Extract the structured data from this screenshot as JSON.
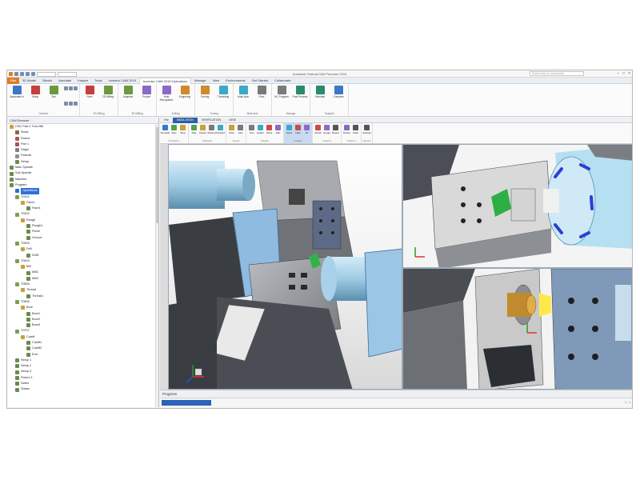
{
  "window": {
    "title": "Autodesk FeatureCAM Premium 2019",
    "search_placeholder": "Search key or commands",
    "controls": [
      "–",
      "□",
      "×"
    ]
  },
  "ribbon": {
    "tabs": [
      "File",
      "3D Model",
      "Sketch",
      "Annotate",
      "Inspect",
      "Tools",
      "Inventor CAM 2019",
      "Inventor CAM 2019 Operations",
      "Manage",
      "View",
      "Environments",
      "Get Started",
      "Collaborate"
    ],
    "active_tab": "Inventor CAM 2019 Operations",
    "groups": [
      {
        "label": "General",
        "buttons": [
          "Associate to",
          "Setup",
          "Tool"
        ]
      },
      {
        "label": "2D Milling",
        "buttons": [
          "Face",
          "2D Milling"
        ]
      },
      {
        "label": "3D Milling",
        "buttons": [
          "Adaptive",
          "Pocket"
        ]
      },
      {
        "label": "Drilling",
        "buttons": [
          "Hole Recognition",
          "Engraving"
        ]
      },
      {
        "label": "Turning",
        "buttons": [
          "Turning",
          "Threading"
        ]
      },
      {
        "label": "Multi-Axis",
        "buttons": [
          "Multi-Axis",
          "Flow"
        ]
      },
      {
        "label": "Manage",
        "buttons": [
          "NC Program",
          "Post Process"
        ]
      },
      {
        "label": "Toolpath",
        "buttons": [
          "Simulate",
          "Compare"
        ]
      }
    ]
  },
  "tree": {
    "header": "CAM Browser",
    "rows": [
      {
        "label": "CNC Part 1 Turn-Mill",
        "indent": 0,
        "color": "#c8a040"
      },
      {
        "label": "Stock",
        "indent": 1,
        "color": "#8a6a3a"
      },
      {
        "label": "Fixture",
        "indent": 1,
        "color": "#a05a5a"
      },
      {
        "label": "Part 1",
        "indent": 1,
        "color": "#b05050"
      },
      {
        "label": "Origin",
        "indent": 1,
        "color": "#808080"
      },
      {
        "label": "Feature",
        "indent": 1,
        "color": "#909090"
      },
      {
        "label": "Setup",
        "indent": 1,
        "color": "#6a8a50"
      },
      {
        "label": "Main Spindle",
        "indent": 0,
        "color": "#6a8a50"
      },
      {
        "label": "Sub Spindle",
        "indent": 0,
        "color": "#6a8a50"
      },
      {
        "label": "Machine",
        "indent": 0,
        "color": "#6a8a50"
      },
      {
        "label": "Program",
        "indent": 0,
        "color": "#6a8a50"
      },
      {
        "label": "Operations",
        "indent": 1,
        "color": "#2f6fd6",
        "selected": true
      },
      {
        "label": "T0101",
        "indent": 1,
        "color": "#7aa04a"
      },
      {
        "label": "Face1",
        "indent": 2,
        "color": "#c9a03a"
      },
      {
        "label": "Face1",
        "indent": 3,
        "color": "#6a8a50"
      },
      {
        "label": "T0202",
        "indent": 1,
        "color": "#7aa04a"
      },
      {
        "label": "Rough",
        "indent": 2,
        "color": "#c9a03a"
      },
      {
        "label": "Rough1",
        "indent": 3,
        "color": "#6a8a50"
      },
      {
        "label": "Finish",
        "indent": 3,
        "color": "#6a8a50"
      },
      {
        "label": "Groove",
        "indent": 3,
        "color": "#6a8a50"
      },
      {
        "label": "T0303",
        "indent": 1,
        "color": "#7aa04a"
      },
      {
        "label": "Drill",
        "indent": 2,
        "color": "#c9a03a"
      },
      {
        "label": "Drill1",
        "indent": 3,
        "color": "#6a8a50"
      },
      {
        "label": "T0404",
        "indent": 1,
        "color": "#7aa04a"
      },
      {
        "label": "Mill",
        "indent": 2,
        "color": "#c9a03a"
      },
      {
        "label": "Mill1",
        "indent": 3,
        "color": "#6a8a50"
      },
      {
        "label": "Mill2",
        "indent": 3,
        "color": "#6a8a50"
      },
      {
        "label": "T0505",
        "indent": 1,
        "color": "#7aa04a"
      },
      {
        "label": "Thread",
        "indent": 2,
        "color": "#c9a03a"
      },
      {
        "label": "Thread1",
        "indent": 3,
        "color": "#6a8a50"
      },
      {
        "label": "T0606",
        "indent": 1,
        "color": "#7aa04a"
      },
      {
        "label": "Bore",
        "indent": 2,
        "color": "#c9a03a"
      },
      {
        "label": "Bore1",
        "indent": 3,
        "color": "#6a8a50"
      },
      {
        "label": "Bore2",
        "indent": 3,
        "color": "#6a8a50"
      },
      {
        "label": "Bore3",
        "indent": 3,
        "color": "#6a8a50"
      },
      {
        "label": "T0707",
        "indent": 1,
        "color": "#7aa04a"
      },
      {
        "label": "Cutoff",
        "indent": 2,
        "color": "#c9a03a"
      },
      {
        "label": "Cutoff1",
        "indent": 3,
        "color": "#6a8a50"
      },
      {
        "label": "Cutoff2",
        "indent": 3,
        "color": "#6a8a50"
      },
      {
        "label": "End",
        "indent": 3,
        "color": "#6a8a50"
      },
      {
        "label": "Setup 1",
        "indent": 1,
        "color": "#6a8a50"
      },
      {
        "label": "Setup 2",
        "indent": 1,
        "color": "#6a8a50"
      },
      {
        "label": "Setup 3",
        "indent": 1,
        "color": "#6a8a50"
      },
      {
        "label": "Fixture 1",
        "indent": 1,
        "color": "#6a8a50"
      },
      {
        "label": "Notes",
        "indent": 1,
        "color": "#6a8a50"
      },
      {
        "label": "Status",
        "indent": 1,
        "color": "#6a8a50"
      }
    ]
  },
  "viewport": {
    "tabs": [
      "File",
      "SIMULATION",
      "VERIFICATION",
      "VIEW"
    ],
    "active_tab": "SIMULATION",
    "toolbar_groups": [
      {
        "label": "Simulation",
        "buttons": [
          "Simulate",
          "Stop",
          "Step"
        ]
      },
      {
        "label": "Playback",
        "buttons": [
          "Play",
          "Pause",
          "Rewind",
          "Forward"
        ]
      },
      {
        "label": "Speed",
        "buttons": [
          "Slow",
          "Fast"
        ]
      },
      {
        "label": "Display",
        "buttons": [
          "Tool",
          "Holder",
          "Stock",
          "Part"
        ]
      },
      {
        "label": "Visibility",
        "buttons": [
          "Show",
          "Hide",
          "Fit"
        ]
      },
      {
        "label": "Analysis",
        "buttons": [
          "Check",
          "Gouge",
          "Report"
        ]
      },
      {
        "label": "Collision",
        "buttons": [
          "Detect",
          "Clear"
        ]
      },
      {
        "label": "Options",
        "buttons": [
          "Settings"
        ]
      }
    ],
    "progress_label": "Progress",
    "right_status": "100%",
    "view_count_label": "1 - 1"
  },
  "colors": {
    "accent": "#2b5ea8",
    "file_tab": "#e07b21",
    "selected": "#2f6fd6"
  }
}
